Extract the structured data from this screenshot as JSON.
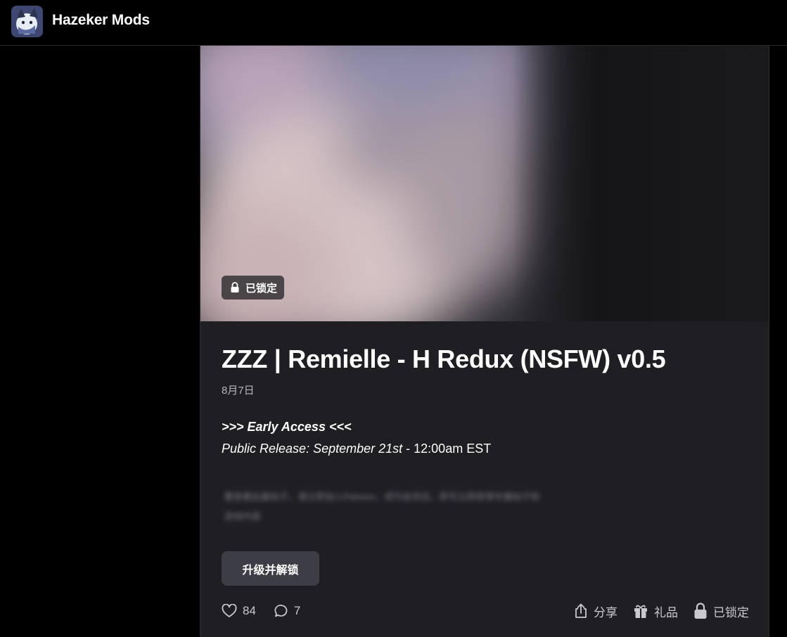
{
  "header": {
    "site_title": "Hazeker Mods",
    "avatar_icon": "creator-avatar"
  },
  "post": {
    "lock_badge": "已锁定",
    "title": "ZZZ | Remielle - H Redux (NSFW) v0.5",
    "date": "8月7日",
    "early_access": ">>> Early Access <<<",
    "release_label": "Public Release: September 21st",
    "release_time": " - 12:00am EST",
    "locked_preview": "要查看此篇帖子，请立即加入Patreon，成为会员后，即可立即获得专属帖子和",
    "locked_preview_2": "其他内容"
  },
  "actions": {
    "upgrade_button": "升级并解锁",
    "likes": "84",
    "comments": "7",
    "share": "分享",
    "gift": "礼品",
    "locked": "已锁定"
  },
  "colors": {
    "page_bg": "#000000",
    "card_bg": "#1f1f23",
    "button_bg": "#3d3d45"
  }
}
